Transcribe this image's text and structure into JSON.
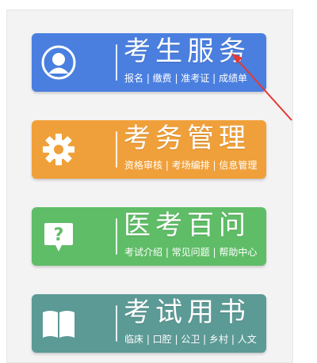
{
  "tiles": [
    {
      "title": "考生服务",
      "subtitle": "报名 | 缴费 | 准考证 | 成绩单",
      "color": "#4a7fe0",
      "icon": "user-avatar-icon"
    },
    {
      "title": "考务管理",
      "subtitle": "资格审核 | 考场编排 | 信息管理",
      "color": "#f0a03a",
      "icon": "gear-icon"
    },
    {
      "title": "医考百问",
      "subtitle": "考试介绍 | 常见问题 | 帮助中心",
      "color": "#5fbd67",
      "icon": "question-chat-icon"
    },
    {
      "title": "考试用书",
      "subtitle": "临床 | 口腔 | 公卫 | 乡村 | 人文",
      "color": "#5c9a96",
      "icon": "open-book-icon"
    }
  ],
  "annotation": {
    "color": "#e53935"
  }
}
